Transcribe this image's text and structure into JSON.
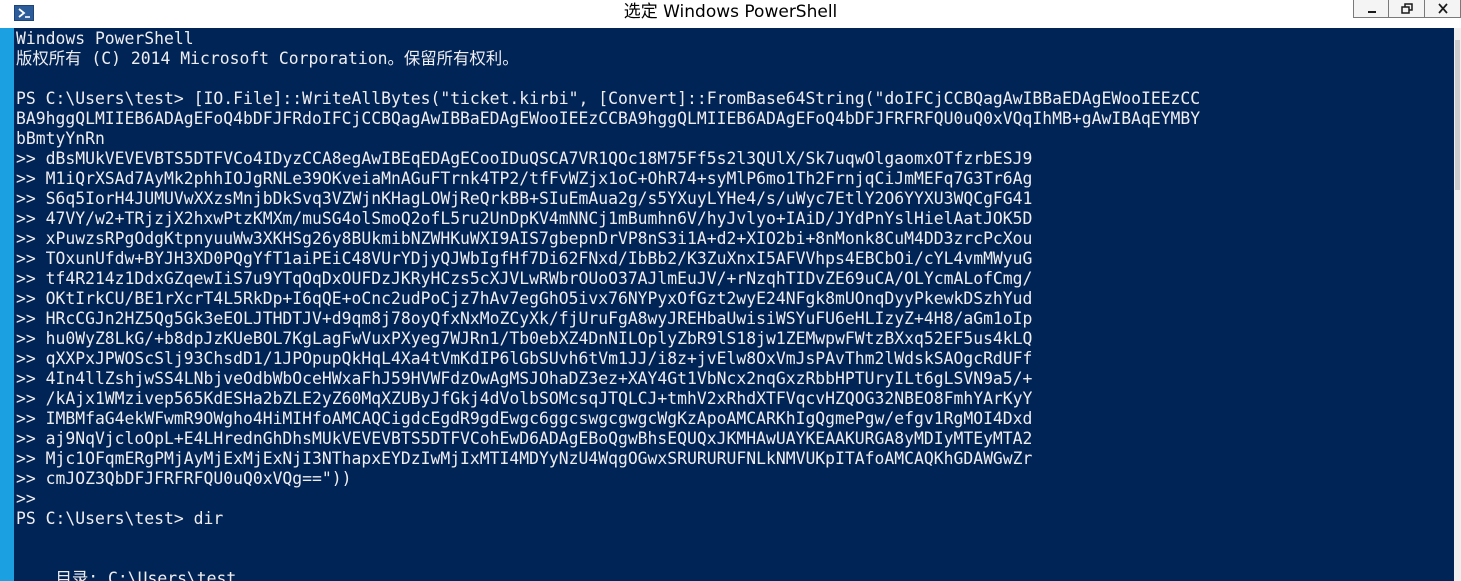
{
  "window": {
    "title": "选定 Windows PowerShell"
  },
  "icons": {
    "app": "powershell-icon",
    "minimize": "minimize-icon",
    "maximize": "maximize-icon",
    "close": "close-icon"
  },
  "colors": {
    "console_background": "#012456",
    "console_text": "#eeedf0",
    "window_frame": "#1ba1e2"
  },
  "console": {
    "lines": [
      "Windows PowerShell",
      "版权所有 (C) 2014 Microsoft Corporation。保留所有权利。",
      "",
      "PS C:\\Users\\test> [IO.File]::WriteAllBytes(\"ticket.kirbi\", [Convert]::FromBase64String(\"doIFCjCCBQagAwIBBaEDAgEWooIEEzCC",
      "BA9hggQLMIIEB6ADAgEFoQ4bDFJFRdoIFCjCCBQagAwIBBaEDAgEWooIEEzCCBA9hggQLMIIEB6ADAgEFoQ4bDFJFRFRFQU0uQ0xVQqIhMB+gAwIBAqEYMBY",
      "bBmtyYnRn",
      ">> dBsMUkVEVEVBTS5DTFVCo4IDyzCCA8egAwIBEqEDAgECooIDuQSCA7VR1QOc18M75Ff5s2l3QUlX/Sk7uqwOlgaomxOTfzrbESJ9",
      ">> M1iQrXSAd7AyMk2phhIOJgRNLe39OKveiaMnAGuFTrnk4TP2/tfFvWZjx1oC+OhR74+syMlP6mo1Th2FrnjqCiJmMEFq7G3Tr6Ag",
      ">> S6q5IorH4JUMUVwXXzsMnjbDkSvq3VZWjnKHagLOWjReQrkBB+SIuEmAua2g/s5YXuyLYHe4/s/uWyc7EtlY2O6YYXU3WQCgFG41",
      ">> 47VY/w2+TRjzjX2hxwPtzKMXm/muSG4olSmoQ2ofL5ru2UnDpKV4mNNCj1mBumhn6V/hyJvlyo+IAiD/JYdPnYslHielAatJOK5D",
      ">> xPuwzsRPgOdgKtpnyuuWw3XKHSg26y8BUkmibNZWHKuWXI9AIS7gbepnDrVP8nS3i1A+d2+XIO2bi+8nMonk8CuM4DD3zrcPcXou",
      ">> TOxunUfdw+BYJH3XD0PQgYfT1aiPEiC48VUrYDjyQJWbIgfHf7Di62FNxd/IbBb2/K3ZuXnxI5AFVVhps4EBCbOi/cYL4vmMWyuG",
      ">> tf4R214z1DdxGZqewIiS7u9YTqOqDxOUFDzJKRyHCzs5cXJVLwRWbrOUoO37AJlmEuJV/+rNzqhTIDvZE69uCA/OLYcmALofCmg/",
      ">> OKtIrkCU/BE1rXcrT4L5RkDp+I6qQE+oCnc2udPoCjz7hAv7egGhO5ivx76NYPyxOfGzt2wyE24NFgk8mUOnqDyyPkewkDSzhYud",
      ">> HRcCGJn2HZ5Qg5Gk3eEOLJTHDTJV+d9qm8j78oyQfxNxMoZCyXk/fjUruFgA8wyJREHbaUwisiWSYuFU6eHLIzyZ+4H8/aGm1oIp",
      ">> hu0WyZ8LkG/+b8dpJzKUeBOL7KgLagFwVuxPXyeg7WJRn1/Tb0ebXZ4DnNILOplyZbR9lS18jw1ZEMwpwFWtzBXxq52EF5us4kLQ",
      ">> qXXPxJPWOScSlj93ChsdD1/1JPOpupQkHqL4Xa4tVmKdIP6lGbSUvh6tVm1JJ/i8z+jvElw8OxVmJsPAvThm2lWdskSAOgcRdUFf",
      ">> 4In4llZshjwSS4LNbjveOdbWbOceHWxaFhJ59HVWFdzOwAgMSJOhaDZ3ez+XAY4Gt1VbNcx2nqGxzRbbHPTUryILt6gLSVN9a5/+",
      ">> /kAjx1WMzivep565KdESHa2bZLE2yZ60MqXZUByJfGkj4dVolbSOMcsqJTQLCJ+tmhV2xRhdXTFVqcvHZQOG32NBEO8FmhYArKyY",
      ">> IMBMfaG4ekWFwmR9OWgho4HiMIHfoAMCAQCigdcEgdR9gdEwgc6ggcswgcgwgcWgKzApoAMCARKhIgQgmePgw/efgv1RgMOI4Dxd",
      ">> aj9NqVjcloOpL+E4LHrednGhDhsMUkVEVEVBTS5DTFVCohEwD6ADAgEBoQgwBhsEQUQxJKMHAwUAYKEAAKURGA8yMDIyMTEyMTA2",
      ">> Mjc1OFqmERgPMjAyMjExMjExNjI3NThapxEYDzIwMjIxMTI4MDYyNzU4WqgOGwxSRURURUFNLkNMVUKpITAfoAMCAQKhGDAWGwZr",
      ">> cmJOZ3QbDFJFRFRFQU0uQ0xVQg==\"))",
      ">>",
      "PS C:\\Users\\test> dir",
      "",
      "",
      "    目录: C:\\Users\\test"
    ]
  }
}
